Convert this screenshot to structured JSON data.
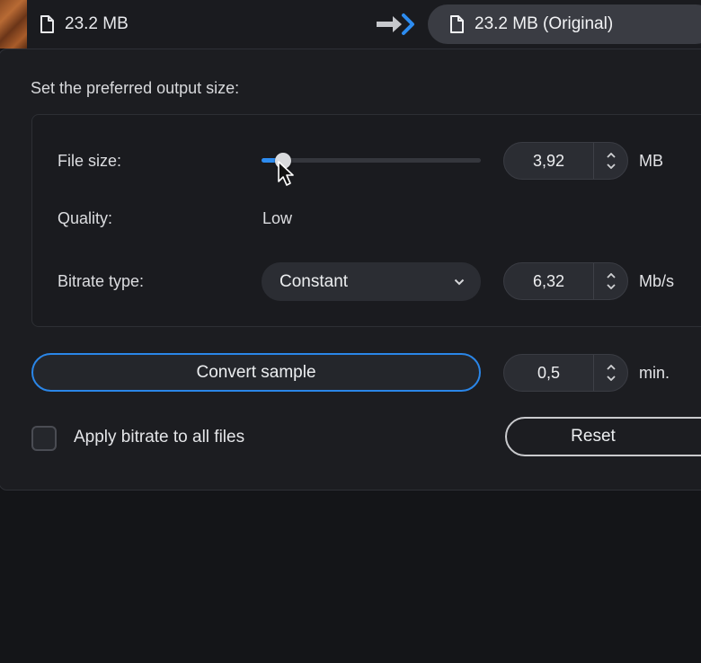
{
  "topbar": {
    "source_size": "23.2 MB",
    "output_size": "23.2 MB (Original)",
    "source_icon": "document-icon",
    "arrow_icon": "double-arrow-right-icon",
    "output_icon": "document-icon"
  },
  "panel": {
    "title": "Set the preferred output size:",
    "file_size": {
      "label": "File size:",
      "slider_fraction": 0.07,
      "value": "3,92",
      "unit": "MB"
    },
    "quality": {
      "label": "Quality:",
      "value": "Low"
    },
    "bitrate": {
      "label": "Bitrate type:",
      "selected": "Constant",
      "value": "6,32",
      "unit": "Mb/s"
    },
    "sample": {
      "button_label": "Convert sample",
      "value": "0,5",
      "unit": "min."
    },
    "apply_all": {
      "label": "Apply bitrate to all files",
      "checked": false
    },
    "reset_label": "Reset"
  },
  "colors": {
    "accent": "#2d8cf0",
    "background": "#141518",
    "panel": "#1c1d21",
    "control": "#2b2d33"
  }
}
